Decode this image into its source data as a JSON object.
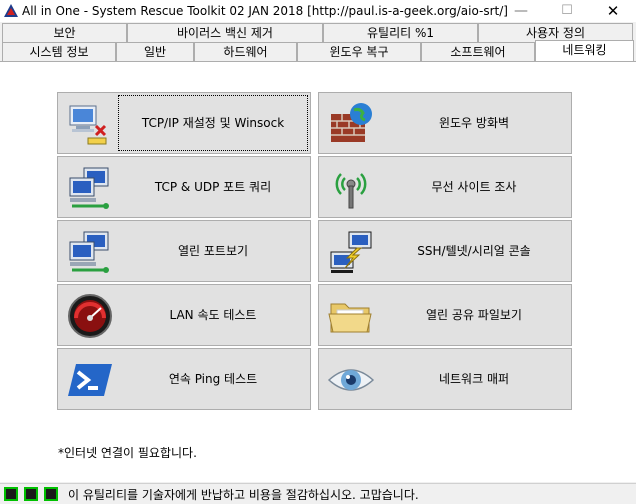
{
  "window": {
    "title": "All in One - System Rescue Toolkit 02 JAN 2018 [http://paul.is-a-geek.org/aio-srt/]",
    "minimize": "—",
    "maximize": "☐",
    "close": "✕"
  },
  "tabs_row1": [
    "보안",
    "바이러스 백신 제거",
    "유틸리티 %1",
    "사용자 정의"
  ],
  "tabs_row2": [
    "시스템 정보",
    "일반",
    "하드웨어",
    "윈도우 복구",
    "소프트웨어",
    "네트워킹"
  ],
  "active_tab": "네트워킹",
  "tools": {
    "tcpip_reset": {
      "label": "TCP/IP 재설정 및 Winsock",
      "icon": "network-reset-icon"
    },
    "firewall": {
      "label": "윈도우 방화벽",
      "icon": "firewall-icon"
    },
    "port_query": {
      "label": "TCP & UDP 포트 쿼리",
      "icon": "network-computers-icon"
    },
    "wireless_survey": {
      "label": "무선 사이트 조사",
      "icon": "wireless-antenna-icon"
    },
    "open_ports": {
      "label": "열린 포트보기",
      "icon": "network-computers-icon"
    },
    "ssh_console": {
      "label": "SSH/텔넷/시리얼 콘솔",
      "icon": "ssh-connection-icon"
    },
    "lan_speed": {
      "label": "LAN 속도 테스트",
      "icon": "speedometer-icon"
    },
    "open_shares": {
      "label": "열린 공유 파일보기",
      "icon": "folder-icon"
    },
    "ping": {
      "label": "연속 Ping 테스트",
      "icon": "powershell-icon"
    },
    "network_mapper": {
      "label": "네트워크 매퍼",
      "icon": "eye-icon"
    }
  },
  "note": "*인터넷 연결이 필요합니다.",
  "status_text": "이 유틸리티를 기술자에게 반납하고 비용을 절감하십시오. 고맙습니다."
}
